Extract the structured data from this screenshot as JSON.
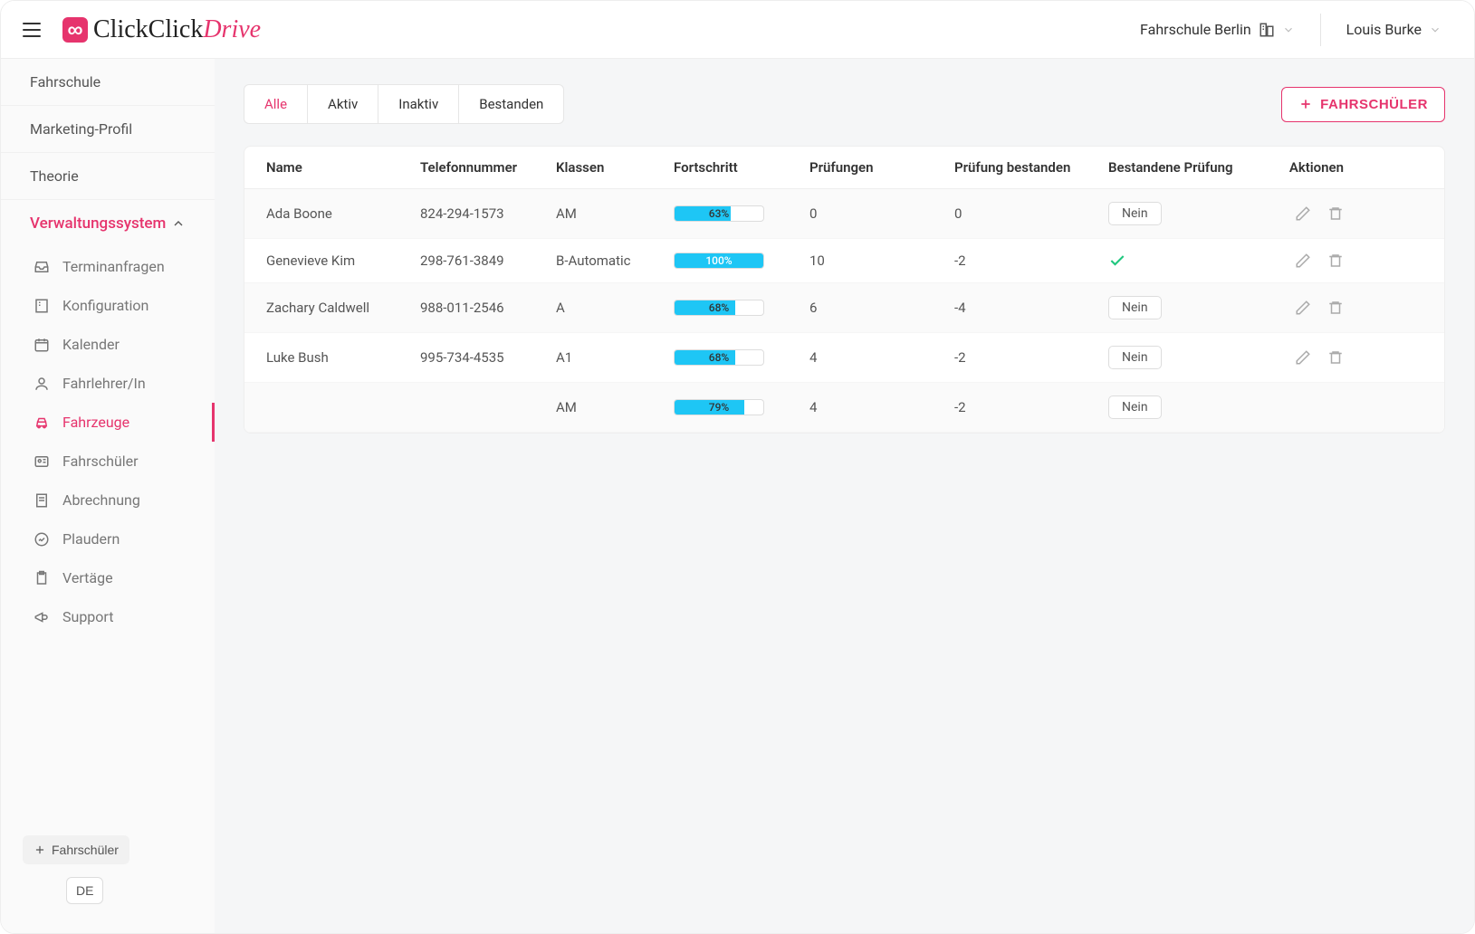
{
  "header": {
    "logo_text1": "ClickClick",
    "logo_text2": "Drive",
    "school": "Fahrschule Berlin",
    "user": "Louis Burke"
  },
  "sidebar": {
    "items": [
      "Fahrschule",
      "Marketing-Profil",
      "Theorie"
    ],
    "section": "Verwaltungssystem",
    "sub": [
      "Terminanfragen",
      "Konfiguration",
      "Kalender",
      "Fahrlehrer/In",
      "Fahrzeuge",
      "Fahrschüler",
      "Abrechnung",
      "Plaudern",
      "Vertäge",
      "Support"
    ],
    "add_student": "Fahrschüler",
    "lang": "DE"
  },
  "tabs": [
    "Alle",
    "Aktiv",
    "Inaktiv",
    "Bestanden"
  ],
  "add_btn": "FAHRSCHÜLER",
  "columns": [
    "Name",
    "Telefonnummer",
    "Klassen",
    "Fortschritt",
    "Prüfungen",
    "Prüfung bestanden",
    "Bestandene Prüfung",
    "Aktionen"
  ],
  "rows": [
    {
      "name": "Ada Boone",
      "phone": "824-294-1573",
      "klassen": "AM",
      "progress": 63,
      "pruefungen": "0",
      "bestanden": "0",
      "passed": false,
      "passed_label": "Nein"
    },
    {
      "name": "Genevieve Kim",
      "phone": "298-761-3849",
      "klassen": "B-Automatic",
      "progress": 100,
      "pruefungen": "10",
      "bestanden": "-2",
      "passed": true,
      "passed_label": ""
    },
    {
      "name": "Zachary Caldwell",
      "phone": "988-011-2546",
      "klassen": "A",
      "progress": 68,
      "pruefungen": "6",
      "bestanden": "-4",
      "passed": false,
      "passed_label": "Nein"
    },
    {
      "name": "Luke Bush",
      "phone": "995-734-4535",
      "klassen": "A1",
      "progress": 68,
      "pruefungen": "4",
      "bestanden": "-2",
      "passed": false,
      "passed_label": "Nein"
    },
    {
      "name": "",
      "phone": "",
      "klassen": "AM",
      "progress": 79,
      "pruefungen": "4",
      "bestanden": "-2",
      "passed": false,
      "passed_label": "Nein"
    }
  ]
}
